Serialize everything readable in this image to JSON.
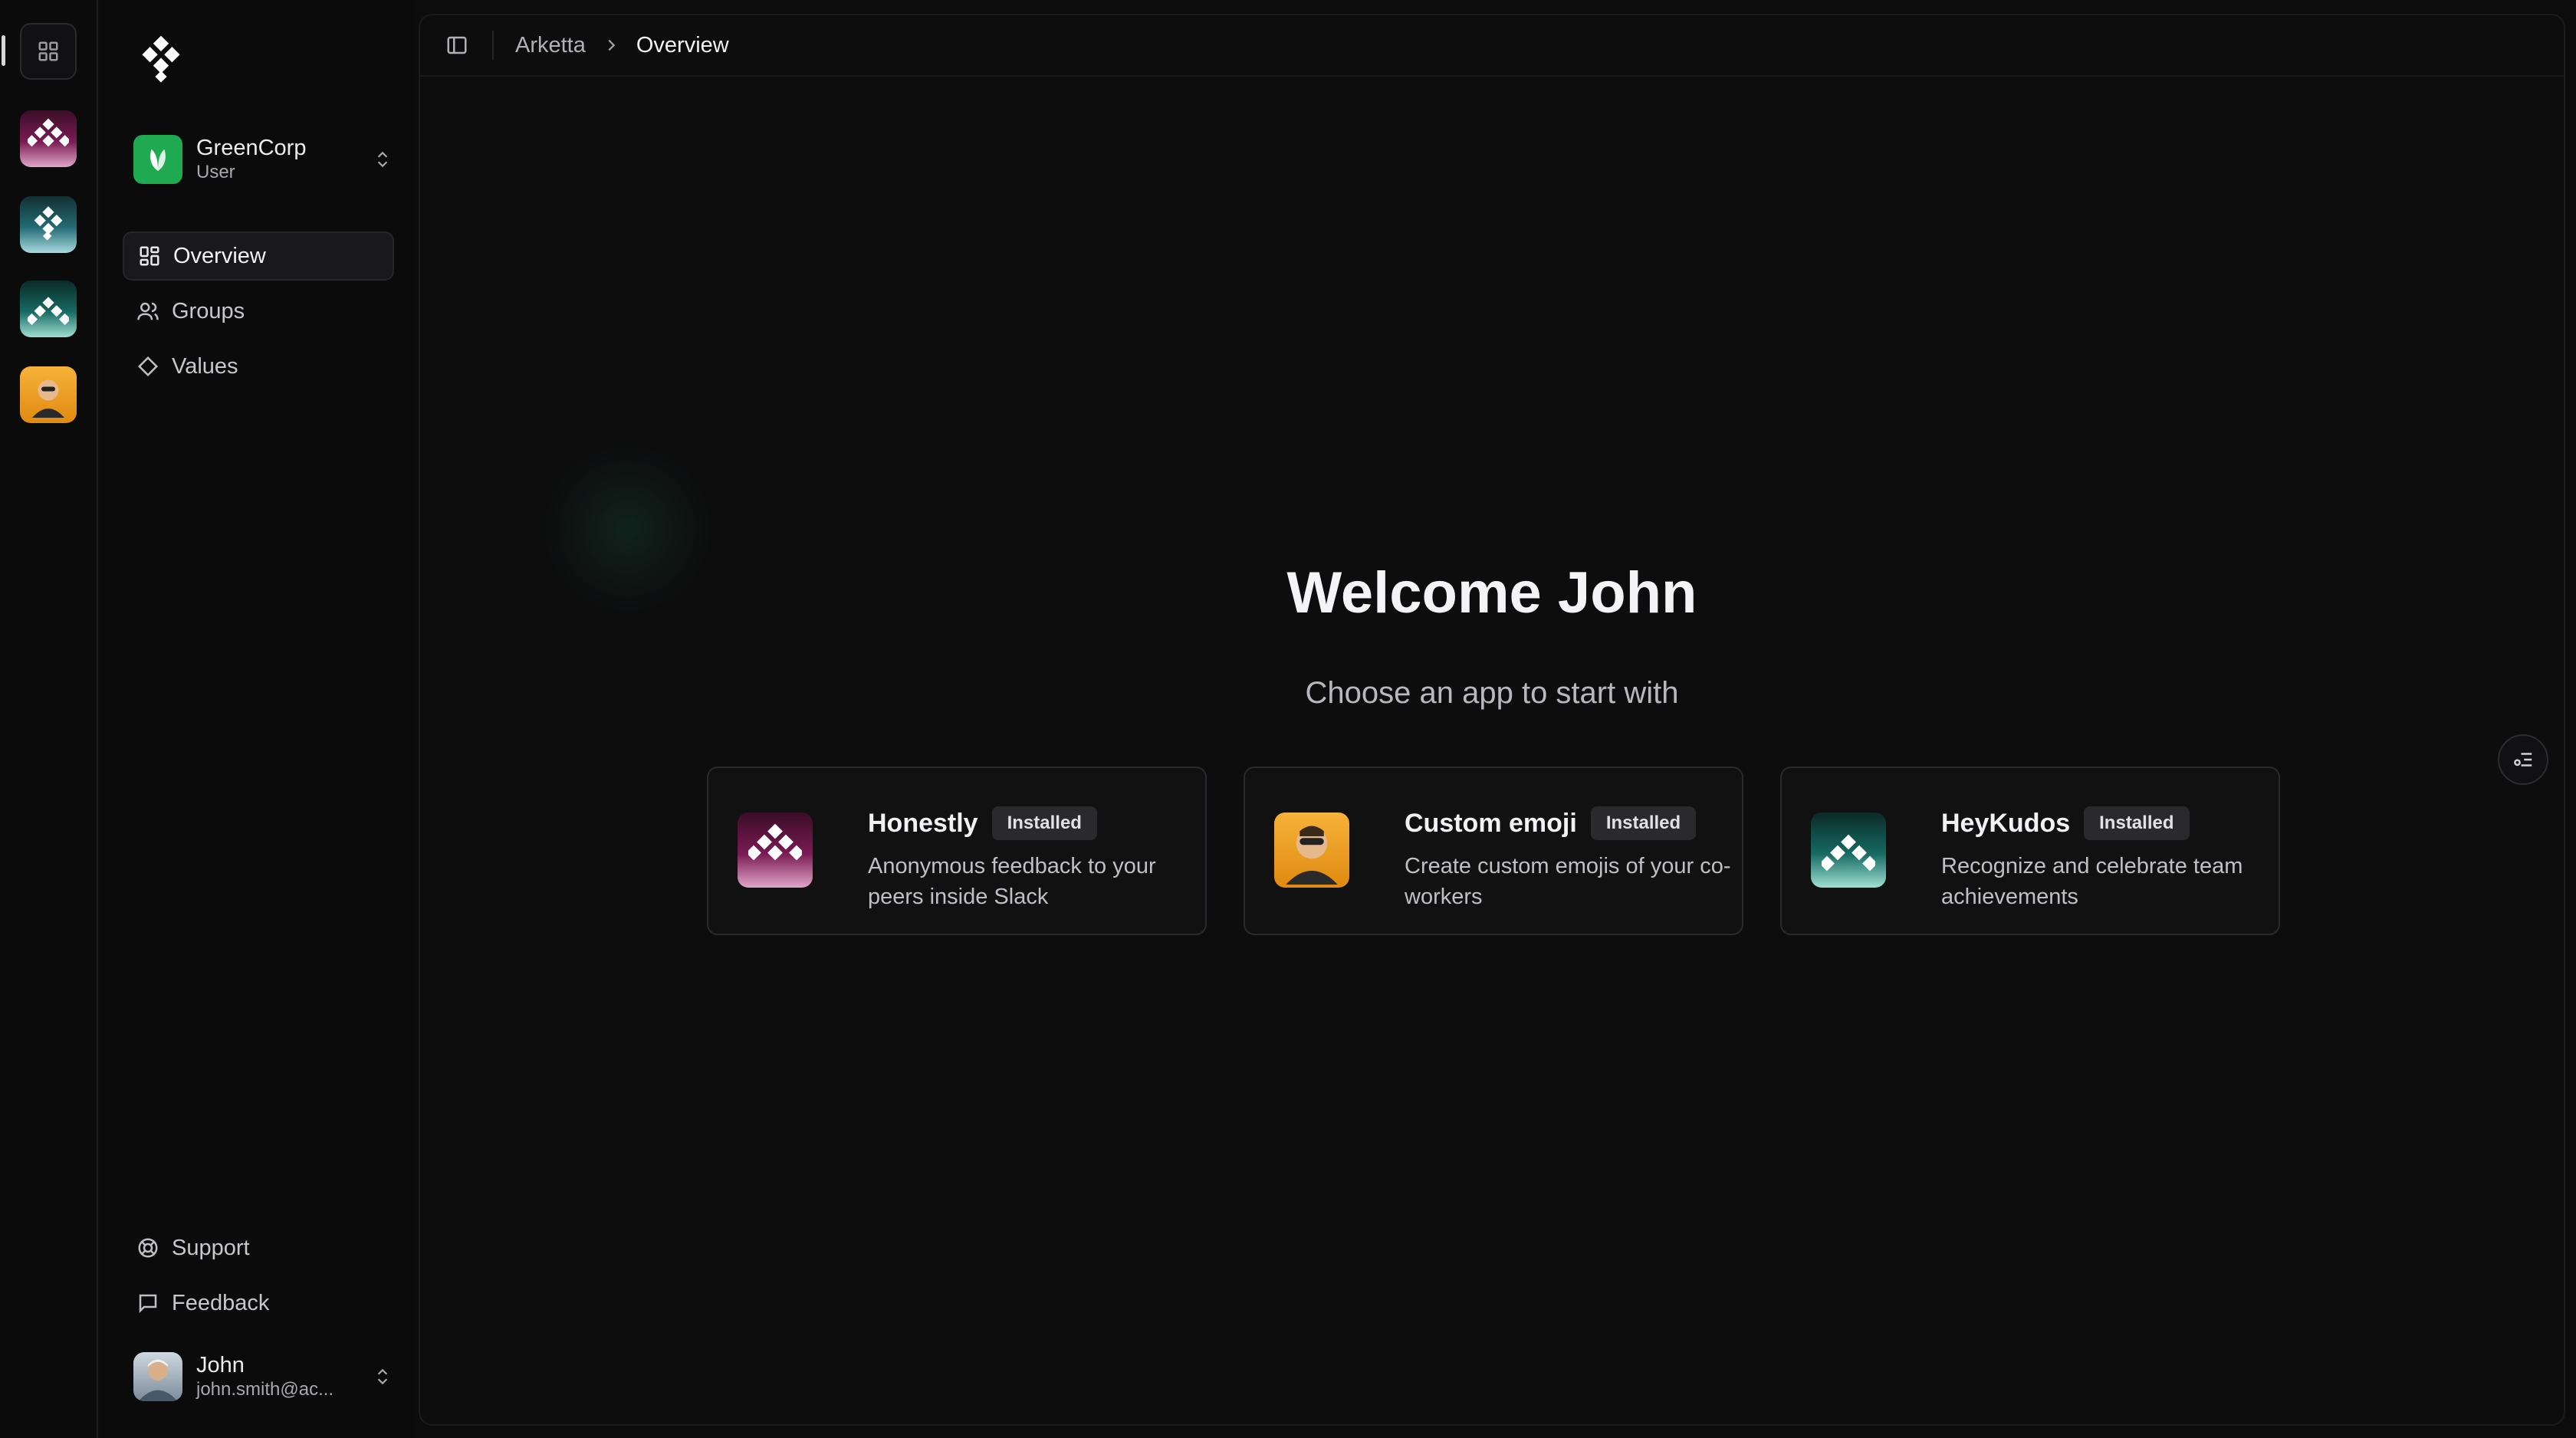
{
  "breadcrumb": {
    "root": "Arketta",
    "current": "Overview"
  },
  "org": {
    "name": "GreenCorp",
    "role": "User"
  },
  "nav": {
    "items": [
      {
        "label": "Overview",
        "icon": "layout-grid-icon",
        "active": true
      },
      {
        "label": "Groups",
        "icon": "users-icon"
      },
      {
        "label": "Values",
        "icon": "diamond-icon"
      }
    ],
    "bottom": [
      {
        "label": "Support",
        "icon": "lifebuoy-icon"
      },
      {
        "label": "Feedback",
        "icon": "message-square-icon"
      }
    ]
  },
  "user": {
    "name": "John",
    "email": "john.smith@ac..."
  },
  "welcome": {
    "title": "Welcome John",
    "subtitle": "Choose an app to start with"
  },
  "apps": [
    {
      "name": "Honestly",
      "badge": "Installed",
      "description": "Anonymous feedback to your peers inside Slack"
    },
    {
      "name": "Custom emoji",
      "badge": "Installed",
      "description": "Create custom emojis of your co-workers"
    },
    {
      "name": "HeyKudos",
      "badge": "Installed",
      "description": "Recognize and celebrate team achievements"
    }
  ],
  "colors": {
    "accent_green": "#1faa52",
    "background": "#0c0c0d",
    "card_border": "#2a2a2d"
  }
}
